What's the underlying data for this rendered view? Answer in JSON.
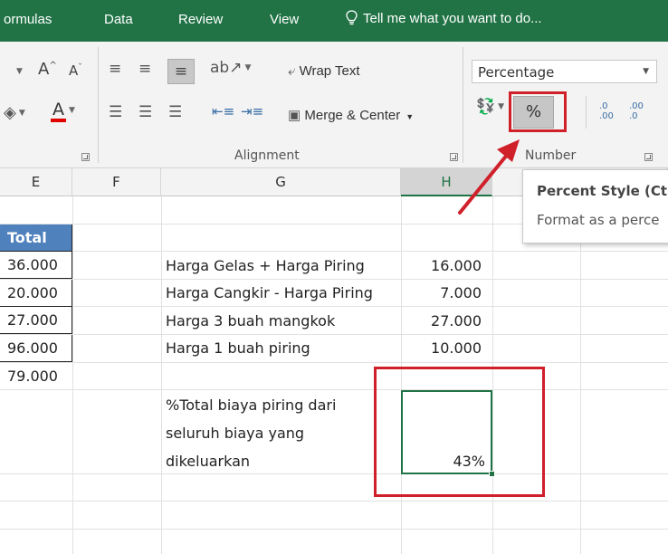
{
  "ribbon_tabs": [
    "ormulas",
    "Data",
    "Review",
    "View"
  ],
  "tell_me": "Tell me what you want to do...",
  "ribbon": {
    "font_grow": "A",
    "font_shrink": "A",
    "wrap_text": "Wrap Text",
    "merge_center": "Merge & Center",
    "alignment_label": "Alignment",
    "number_label": "Number",
    "number_format": "Percentage",
    "percent_symbol": "%",
    "increase_decimal": ".0\n.00",
    "decrease_decimal": ".00\n.0"
  },
  "columns": [
    "E",
    "F",
    "G",
    "H"
  ],
  "selected_column": "H",
  "col_e": {
    "header": "Total",
    "values": [
      "36.000",
      "20.000",
      "27.000",
      "96.000",
      "79.000"
    ]
  },
  "rows": [
    {
      "label": "Harga Gelas + Harga Piring",
      "value": "16.000"
    },
    {
      "label": "Harga Cangkir - Harga Piring",
      "value": "7.000"
    },
    {
      "label": "Harga 3 buah mangkok",
      "value": "27.000"
    },
    {
      "label": "Harga 1 buah piring",
      "value": "10.000"
    }
  ],
  "question_lines": [
    "%Total biaya piring dari",
    "seluruh biaya yang",
    "dikeluarkan"
  ],
  "result": "43%",
  "tooltip": {
    "title": "Percent Style (Ct",
    "description": "Format as a perce"
  },
  "colors": {
    "excel_green": "#217346",
    "highlight_red": "#d0202a",
    "header_blue": "#4f81bd"
  }
}
